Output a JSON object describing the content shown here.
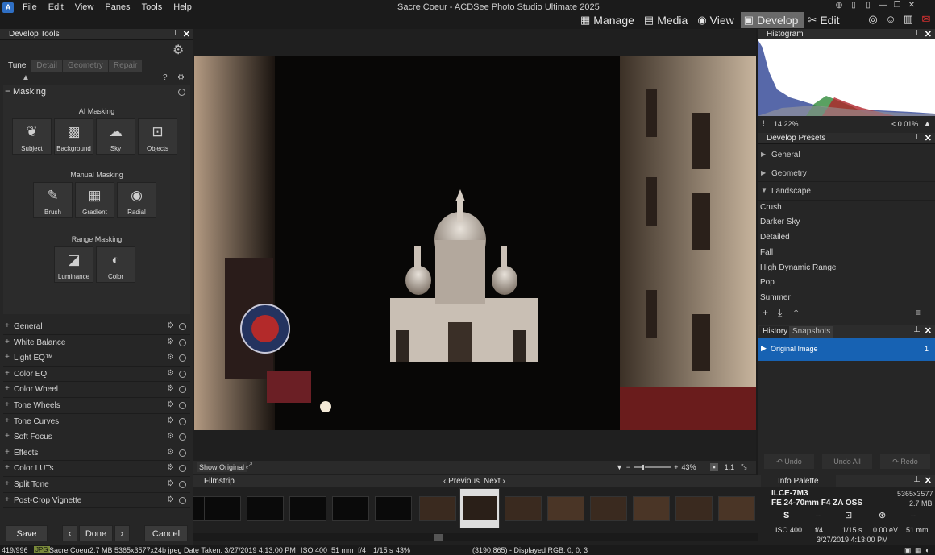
{
  "window": {
    "title": "Sacre Coeur - ACDSee Photo Studio Ultimate 2025",
    "menu": [
      "File",
      "Edit",
      "View",
      "Panes",
      "Tools",
      "Help"
    ],
    "modes": [
      {
        "label": "Manage",
        "icon": "grid-icon",
        "glyph": "▦"
      },
      {
        "label": "Media",
        "icon": "media-icon",
        "glyph": "▤"
      },
      {
        "label": "View",
        "icon": "eye-icon",
        "glyph": "◉"
      },
      {
        "label": "Develop",
        "icon": "develop-icon",
        "glyph": "▣"
      },
      {
        "label": "Edit",
        "icon": "edit-icon",
        "glyph": "✂"
      }
    ],
    "active_mode": "Develop"
  },
  "left_panel": {
    "title": "Develop Tools",
    "tabs": [
      "Tune",
      "Detail",
      "Geometry",
      "Repair"
    ],
    "active_tab": "Tune",
    "masking": {
      "title": "Masking",
      "ai_label": "AI Masking",
      "ai_buttons": [
        "Subject",
        "Background",
        "Sky",
        "Objects"
      ],
      "manual_label": "Manual Masking",
      "manual_buttons": [
        "Brush",
        "Gradient",
        "Radial"
      ],
      "range_label": "Range Masking",
      "range_buttons": [
        "Luminance",
        "Color"
      ]
    },
    "sections": [
      "General",
      "White Balance",
      "Light EQ™",
      "Color EQ",
      "Color Wheel",
      "Tone Wheels",
      "Tone Curves",
      "Soft Focus",
      "Effects",
      "Color LUTs",
      "Split Tone",
      "Post-Crop Vignette"
    ],
    "buttons": {
      "save": "Save",
      "done": "Done",
      "cancel": "Cancel"
    }
  },
  "viewer": {
    "show_original": "Show Original",
    "zoom": "43%",
    "ratio": "1:1"
  },
  "filmstrip": {
    "title": "Filmstrip",
    "previous": "Previous",
    "next": "Next"
  },
  "right_panel": {
    "histogram_title": "Histogram",
    "histogram_left": "14.22%",
    "histogram_right": "< 0.01%",
    "presets_title": "Develop Presets",
    "preset_groups": [
      "General",
      "Geometry",
      "Landscape"
    ],
    "landscape_items": [
      "Crush",
      "Darker Sky",
      "Detailed",
      "Fall",
      "High Dynamic Range",
      "Pop",
      "Summer"
    ],
    "history_tabs": [
      "History",
      "Snapshots"
    ],
    "history_item": "Original Image",
    "history_count": "1",
    "undo_buttons": [
      "Undo",
      "Undo All",
      "Redo"
    ],
    "info_title": "Info Palette",
    "info": {
      "camera": "ILCE-7M3",
      "dimensions": "5365x3577",
      "lens": "FE 24-70mm F4 ZA OSS",
      "size": "2.7 MB",
      "mode": "S",
      "dash1": "--",
      "dash2": "--",
      "iso": "ISO 400",
      "aperture": "f/4",
      "shutter": "1/15 s",
      "ev": "0.00 eV",
      "focal": "51 mm",
      "date": "3/27/2019 4:13:00 PM"
    }
  },
  "status": {
    "count": "419/996",
    "format": "JPG",
    "name": "Sacre Coeur",
    "size": "2.7 MB",
    "dims": "5365x3577x24b jpeg",
    "date_taken": "Date Taken: 3/27/2019 4:13:00 PM",
    "iso": "ISO 400",
    "focal": "51 mm",
    "aperture": "f/4",
    "shutter": "1/15 s",
    "zoom": "43%",
    "pixel": "(3190,865) - Displayed RGB: 0, 0, 3"
  },
  "colors": {
    "accent": "#1762b3",
    "active_mode_bg": "#6a6a6a"
  }
}
